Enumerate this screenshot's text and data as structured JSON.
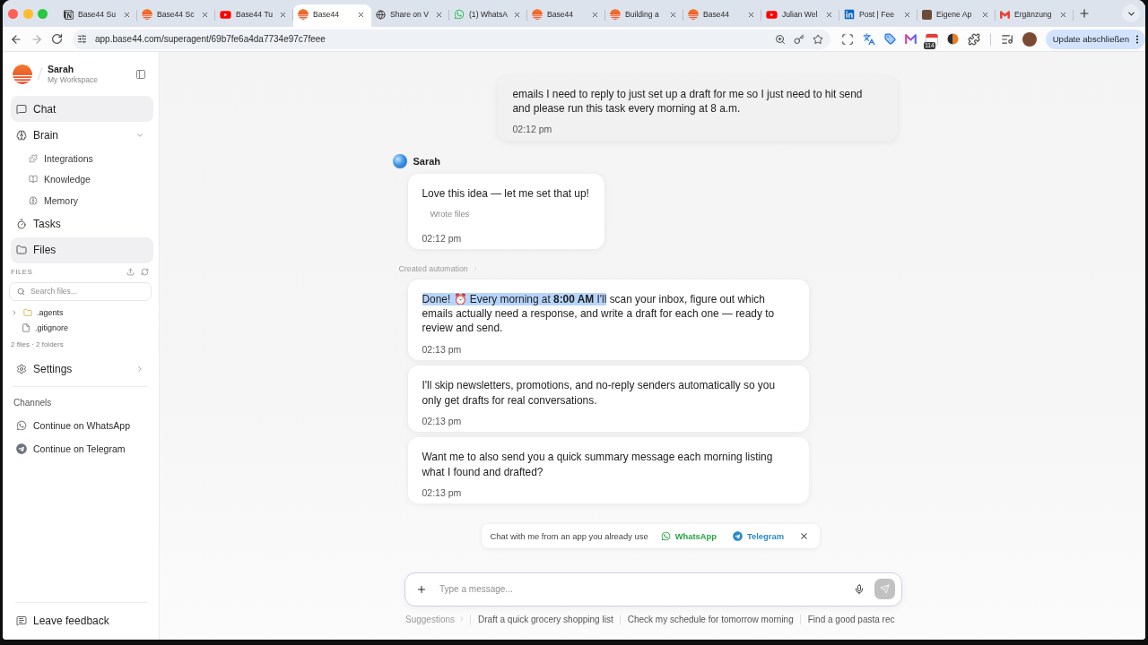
{
  "browser": {
    "tabs": [
      {
        "title": "Base44 Su",
        "selected": false
      },
      {
        "title": "Base44 Sc",
        "selected": false
      },
      {
        "title": "Base44 Tu",
        "selected": false
      },
      {
        "title": "Base44",
        "selected": true
      },
      {
        "title": "Share on V",
        "selected": false
      },
      {
        "title": "(1) WhatsA",
        "selected": false
      },
      {
        "title": "Base44",
        "selected": false
      },
      {
        "title": "Building a",
        "selected": false
      },
      {
        "title": "Base44",
        "selected": false
      },
      {
        "title": "Julian Wel",
        "selected": false
      },
      {
        "title": "Post | Fee",
        "selected": false
      },
      {
        "title": "Eigene Ap",
        "selected": false
      },
      {
        "title": "Ergänzung",
        "selected": false
      }
    ],
    "url": "app.base44.com/superagent/69b7fe6a4da7734e97c7feee",
    "extension_badge": "114",
    "update_button": "Update abschließen"
  },
  "sidebar": {
    "workspace": {
      "user": "Sarah",
      "name": "My Workspace"
    },
    "nav": [
      {
        "label": "Chat",
        "selected": true
      },
      {
        "label": "Brain",
        "selected": false,
        "expanded": true,
        "children": [
          {
            "label": "Integrations",
            "selected": false
          },
          {
            "label": "Knowledge",
            "selected": false
          },
          {
            "label": "Memory",
            "selected": false
          }
        ]
      },
      {
        "label": "Tasks",
        "selected": false
      },
      {
        "label": "Files",
        "selected": true
      }
    ],
    "files": {
      "heading": "FILES",
      "search": {
        "placeholder": "Search files..."
      },
      "tree": [
        {
          "name": ".agents",
          "kind": "folder",
          "expanded": false
        },
        {
          "name": ".gitignore",
          "kind": "file"
        }
      ],
      "summary": "2 files · 2 folders"
    },
    "settings": {
      "label": "Settings",
      "selected": false,
      "expanded": false
    },
    "channels": {
      "heading": "Channels",
      "items": [
        {
          "label": "Continue on WhatsApp"
        },
        {
          "label": "Continue on Telegram"
        }
      ]
    },
    "feedback": "Leave feedback"
  },
  "chat": {
    "messages": [
      {
        "kind": "user",
        "text": "emails I need to reply to just set up a draft for me so I just need to hit send and please run this task every morning at 8 a.m.",
        "time": "02:12 pm"
      },
      {
        "kind": "sender",
        "name": "Sarah"
      },
      {
        "kind": "assistant",
        "segments": [
          {
            "text": "Love this idea — let me set that up!",
            "highlighted": false
          }
        ],
        "activity": "Wrote files",
        "time": "02:12 pm"
      },
      {
        "kind": "event",
        "label": "Created automation",
        "expanded": false
      },
      {
        "kind": "assistant",
        "segments": [
          {
            "text": "Done! ⏰ Every morning at **8:00 AM** I'll",
            "highlighted": true
          },
          {
            "text": "scan your inbox, figure out which emails actually need a response, and write a draft for each one — ready to review and send.",
            "highlighted": false
          }
        ],
        "time": "02:13 pm"
      },
      {
        "kind": "assistant",
        "segments": [
          {
            "text": "I'll skip newsletters, promotions, and no-reply senders automatically so you only get drafts for real conversations.",
            "highlighted": false
          }
        ],
        "time": "02:13 pm"
      },
      {
        "kind": "assistant",
        "segments": [
          {
            "text": "Want me to also send you a quick summary message each morning listing what I found and drafted?",
            "highlighted": false
          }
        ],
        "time": "02:13 pm"
      }
    ],
    "channel_banner": {
      "text": "Chat with me from an app you already use",
      "links": [
        {
          "label": "WhatsApp",
          "color": "#25a244"
        },
        {
          "label": "Telegram",
          "color": "#2a8bc8"
        }
      ]
    },
    "composer": {
      "placeholder": "Type a message...",
      "send_disabled": true
    },
    "suggestions": {
      "label": "Suggestions",
      "items": [
        "Draft a quick grocery shopping list",
        "Check my schedule for tomorrow morning",
        "Find a good pasta rec"
      ]
    }
  }
}
